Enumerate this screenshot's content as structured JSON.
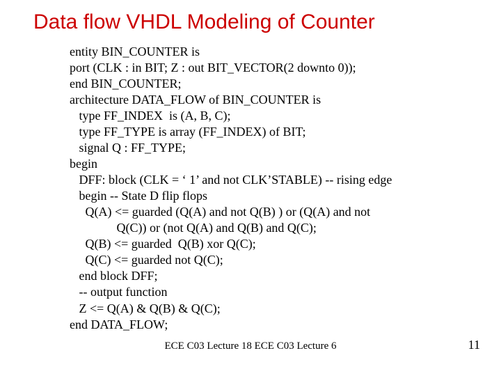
{
  "title": "Data flow VHDL Modeling of Counter",
  "code": {
    "l1": "entity BIN_COUNTER is",
    "l2": "port (CLK : in BIT; Z : out BIT_VECTOR(2 downto 0));",
    "l3": "end BIN_COUNTER;",
    "l4": "architecture DATA_FLOW of BIN_COUNTER is",
    "l5": "   type FF_INDEX  is (A, B, C);",
    "l6": "   type FF_TYPE is array (FF_INDEX) of BIT;",
    "l7": "   signal Q : FF_TYPE;",
    "l8": "begin",
    "l9": "   DFF: block (CLK = ‘ 1’ and not CLK’STABLE) -- rising edge",
    "l10": "   begin -- State D flip flops",
    "l11": "     Q(A) <= guarded (Q(A) and not Q(B) ) or (Q(A) and not",
    "l12": "               Q(C)) or (not Q(A) and Q(B) and Q(C);",
    "l13": "     Q(B) <= guarded  Q(B) xor Q(C);",
    "l14": "     Q(C) <= guarded not Q(C);",
    "l15": "   end block DFF;",
    "l16": "   -- output function",
    "l17": "   Z <= Q(A) & Q(B) & Q(C);",
    "l18": "end DATA_FLOW;"
  },
  "footer_center": "ECE C03 Lecture 18 ECE C03 Lecture 6",
  "page_number": "11"
}
